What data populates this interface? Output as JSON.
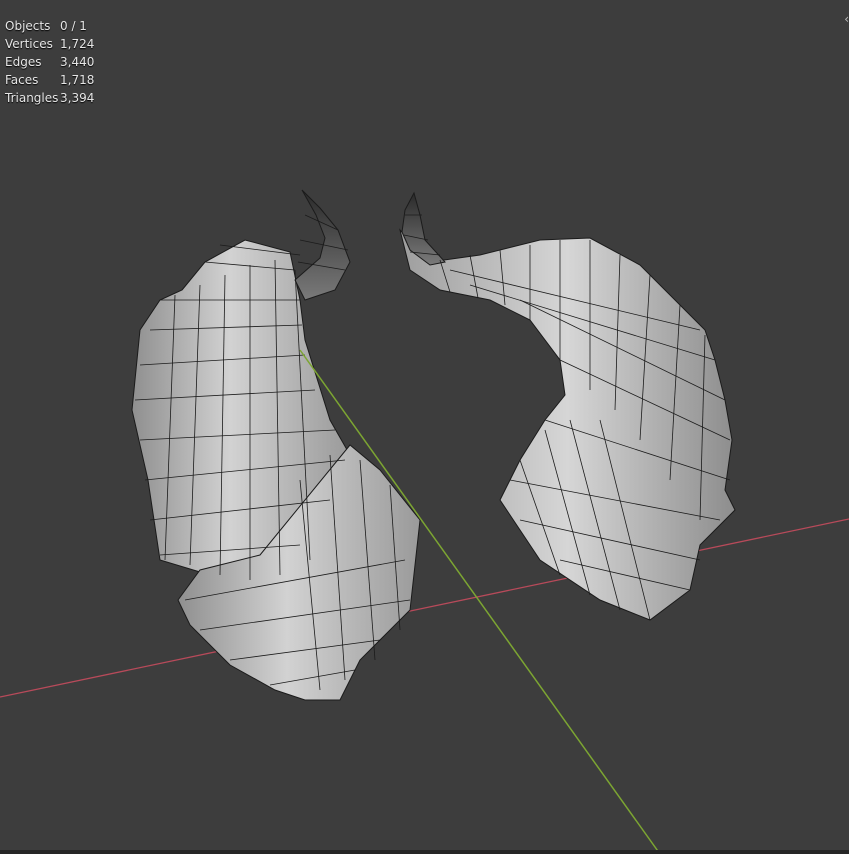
{
  "stats": [
    {
      "label": "Objects",
      "value": "0 / 1"
    },
    {
      "label": "Vertices",
      "value": "1,724"
    },
    {
      "label": "Edges",
      "value": "3,440"
    },
    {
      "label": "Faces",
      "value": "1,718"
    },
    {
      "label": "Triangles",
      "value": "3,394"
    }
  ],
  "colors": {
    "background": "#3d3d3d",
    "x_axis": "#b84a5a",
    "y_axis": "#7ca532",
    "mesh_fill": "#b5b5b5",
    "wire": "#1b1b1b"
  },
  "icons": {
    "sidebar_toggle": "chevron-left-icon"
  }
}
